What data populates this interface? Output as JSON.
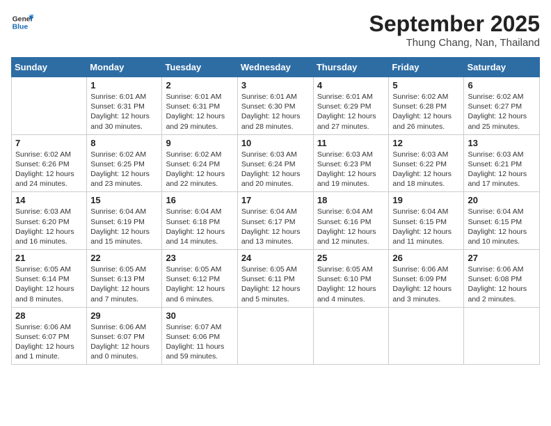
{
  "header": {
    "logo_text_general": "General",
    "logo_text_blue": "Blue",
    "month_year": "September 2025",
    "location": "Thung Chang, Nan, Thailand"
  },
  "calendar": {
    "days_of_week": [
      "Sunday",
      "Monday",
      "Tuesday",
      "Wednesday",
      "Thursday",
      "Friday",
      "Saturday"
    ],
    "weeks": [
      [
        {
          "day": "",
          "info": ""
        },
        {
          "day": "1",
          "info": "Sunrise: 6:01 AM\nSunset: 6:31 PM\nDaylight: 12 hours\nand 30 minutes."
        },
        {
          "day": "2",
          "info": "Sunrise: 6:01 AM\nSunset: 6:31 PM\nDaylight: 12 hours\nand 29 minutes."
        },
        {
          "day": "3",
          "info": "Sunrise: 6:01 AM\nSunset: 6:30 PM\nDaylight: 12 hours\nand 28 minutes."
        },
        {
          "day": "4",
          "info": "Sunrise: 6:01 AM\nSunset: 6:29 PM\nDaylight: 12 hours\nand 27 minutes."
        },
        {
          "day": "5",
          "info": "Sunrise: 6:02 AM\nSunset: 6:28 PM\nDaylight: 12 hours\nand 26 minutes."
        },
        {
          "day": "6",
          "info": "Sunrise: 6:02 AM\nSunset: 6:27 PM\nDaylight: 12 hours\nand 25 minutes."
        }
      ],
      [
        {
          "day": "7",
          "info": "Sunrise: 6:02 AM\nSunset: 6:26 PM\nDaylight: 12 hours\nand 24 minutes."
        },
        {
          "day": "8",
          "info": "Sunrise: 6:02 AM\nSunset: 6:25 PM\nDaylight: 12 hours\nand 23 minutes."
        },
        {
          "day": "9",
          "info": "Sunrise: 6:02 AM\nSunset: 6:24 PM\nDaylight: 12 hours\nand 22 minutes."
        },
        {
          "day": "10",
          "info": "Sunrise: 6:03 AM\nSunset: 6:24 PM\nDaylight: 12 hours\nand 20 minutes."
        },
        {
          "day": "11",
          "info": "Sunrise: 6:03 AM\nSunset: 6:23 PM\nDaylight: 12 hours\nand 19 minutes."
        },
        {
          "day": "12",
          "info": "Sunrise: 6:03 AM\nSunset: 6:22 PM\nDaylight: 12 hours\nand 18 minutes."
        },
        {
          "day": "13",
          "info": "Sunrise: 6:03 AM\nSunset: 6:21 PM\nDaylight: 12 hours\nand 17 minutes."
        }
      ],
      [
        {
          "day": "14",
          "info": "Sunrise: 6:03 AM\nSunset: 6:20 PM\nDaylight: 12 hours\nand 16 minutes."
        },
        {
          "day": "15",
          "info": "Sunrise: 6:04 AM\nSunset: 6:19 PM\nDaylight: 12 hours\nand 15 minutes."
        },
        {
          "day": "16",
          "info": "Sunrise: 6:04 AM\nSunset: 6:18 PM\nDaylight: 12 hours\nand 14 minutes."
        },
        {
          "day": "17",
          "info": "Sunrise: 6:04 AM\nSunset: 6:17 PM\nDaylight: 12 hours\nand 13 minutes."
        },
        {
          "day": "18",
          "info": "Sunrise: 6:04 AM\nSunset: 6:16 PM\nDaylight: 12 hours\nand 12 minutes."
        },
        {
          "day": "19",
          "info": "Sunrise: 6:04 AM\nSunset: 6:15 PM\nDaylight: 12 hours\nand 11 minutes."
        },
        {
          "day": "20",
          "info": "Sunrise: 6:04 AM\nSunset: 6:15 PM\nDaylight: 12 hours\nand 10 minutes."
        }
      ],
      [
        {
          "day": "21",
          "info": "Sunrise: 6:05 AM\nSunset: 6:14 PM\nDaylight: 12 hours\nand 8 minutes."
        },
        {
          "day": "22",
          "info": "Sunrise: 6:05 AM\nSunset: 6:13 PM\nDaylight: 12 hours\nand 7 minutes."
        },
        {
          "day": "23",
          "info": "Sunrise: 6:05 AM\nSunset: 6:12 PM\nDaylight: 12 hours\nand 6 minutes."
        },
        {
          "day": "24",
          "info": "Sunrise: 6:05 AM\nSunset: 6:11 PM\nDaylight: 12 hours\nand 5 minutes."
        },
        {
          "day": "25",
          "info": "Sunrise: 6:05 AM\nSunset: 6:10 PM\nDaylight: 12 hours\nand 4 minutes."
        },
        {
          "day": "26",
          "info": "Sunrise: 6:06 AM\nSunset: 6:09 PM\nDaylight: 12 hours\nand 3 minutes."
        },
        {
          "day": "27",
          "info": "Sunrise: 6:06 AM\nSunset: 6:08 PM\nDaylight: 12 hours\nand 2 minutes."
        }
      ],
      [
        {
          "day": "28",
          "info": "Sunrise: 6:06 AM\nSunset: 6:07 PM\nDaylight: 12 hours\nand 1 minute."
        },
        {
          "day": "29",
          "info": "Sunrise: 6:06 AM\nSunset: 6:07 PM\nDaylight: 12 hours\nand 0 minutes."
        },
        {
          "day": "30",
          "info": "Sunrise: 6:07 AM\nSunset: 6:06 PM\nDaylight: 11 hours\nand 59 minutes."
        },
        {
          "day": "",
          "info": ""
        },
        {
          "day": "",
          "info": ""
        },
        {
          "day": "",
          "info": ""
        },
        {
          "day": "",
          "info": ""
        }
      ]
    ]
  }
}
